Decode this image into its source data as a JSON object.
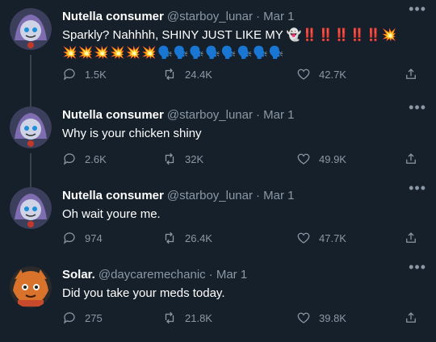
{
  "tweets": [
    {
      "name": "Nutella consumer",
      "handle": "@starboy_lunar",
      "date": "· Mar 1",
      "text": "Sparkly? Nahhhh, SHINY JUST LIKE MY",
      "emoji_line1": "👻‼️‼️‼️‼️‼️💥",
      "emoji_line2": "💥💥💥💥💥💥🗣️🗣️🗣️🗣️🗣️🗣️🗣️🗣️",
      "replies": "1.5K",
      "retweets": "24.4K",
      "likes": "42.7K"
    },
    {
      "name": "Nutella consumer",
      "handle": "@starboy_lunar",
      "date": "· Mar 1",
      "text": "Why is your chicken shiny",
      "replies": "2.6K",
      "retweets": "32K",
      "likes": "49.9K"
    },
    {
      "name": "Nutella consumer",
      "handle": "@starboy_lunar",
      "date": "· Mar 1",
      "text": "Oh wait youre me.",
      "replies": "974",
      "retweets": "26.4K",
      "likes": "47.7K"
    },
    {
      "name": "Solar.",
      "handle": "@daycaremechanic",
      "date": "· Mar 1",
      "text": "Did you take your meds today.",
      "replies": "275",
      "retweets": "21.8K",
      "likes": "39.8K"
    }
  ],
  "icons": {
    "more": "more-icon",
    "reply": "reply-icon",
    "retweet": "retweet-icon",
    "like": "heart-icon",
    "share": "share-icon"
  },
  "colors": {
    "background": "#15202b",
    "secondary_text": "#8b98a5",
    "thread_line": "#38444d"
  }
}
